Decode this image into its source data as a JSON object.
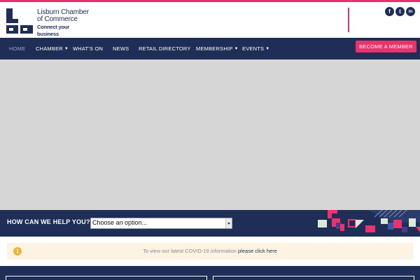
{
  "brand": {
    "name_line1": "Lisburn Chamber",
    "name_line2": "of Commerce",
    "tagline": "Connect your business",
    "colors": {
      "navy": "#1e2e57",
      "pink": "#e8336d",
      "notice_bg": "#fdf3e2",
      "notice_icon": "#f0b13a",
      "hero_bg": "#d6d6d6"
    }
  },
  "social": [
    {
      "name": "facebook-icon",
      "glyph": "f"
    },
    {
      "name": "twitter-icon",
      "glyph": "t"
    },
    {
      "name": "linkedin-icon",
      "glyph": "in"
    }
  ],
  "nav": {
    "items": [
      {
        "label": "HOME",
        "active": true,
        "has_dropdown": false
      },
      {
        "label": "CHAMBER",
        "active": false,
        "has_dropdown": true
      },
      {
        "label": "WHAT'S ON",
        "active": false,
        "has_dropdown": false
      },
      {
        "label": "NEWS",
        "active": false,
        "has_dropdown": false
      },
      {
        "label": "RETAIL DIRECTORY",
        "active": false,
        "has_dropdown": false
      },
      {
        "label": "MEMBERSHIP",
        "active": false,
        "has_dropdown": true
      },
      {
        "label": "EVENTS",
        "active": false,
        "has_dropdown": true
      }
    ],
    "cta_label": "BECOME A MEMBER"
  },
  "help": {
    "label": "HOW CAN WE HELP YOU?",
    "select_value": "Choose an option..."
  },
  "notice": {
    "icon": "info-icon",
    "text": "To view our latest COVID-19 information",
    "link_text": "please click here"
  }
}
